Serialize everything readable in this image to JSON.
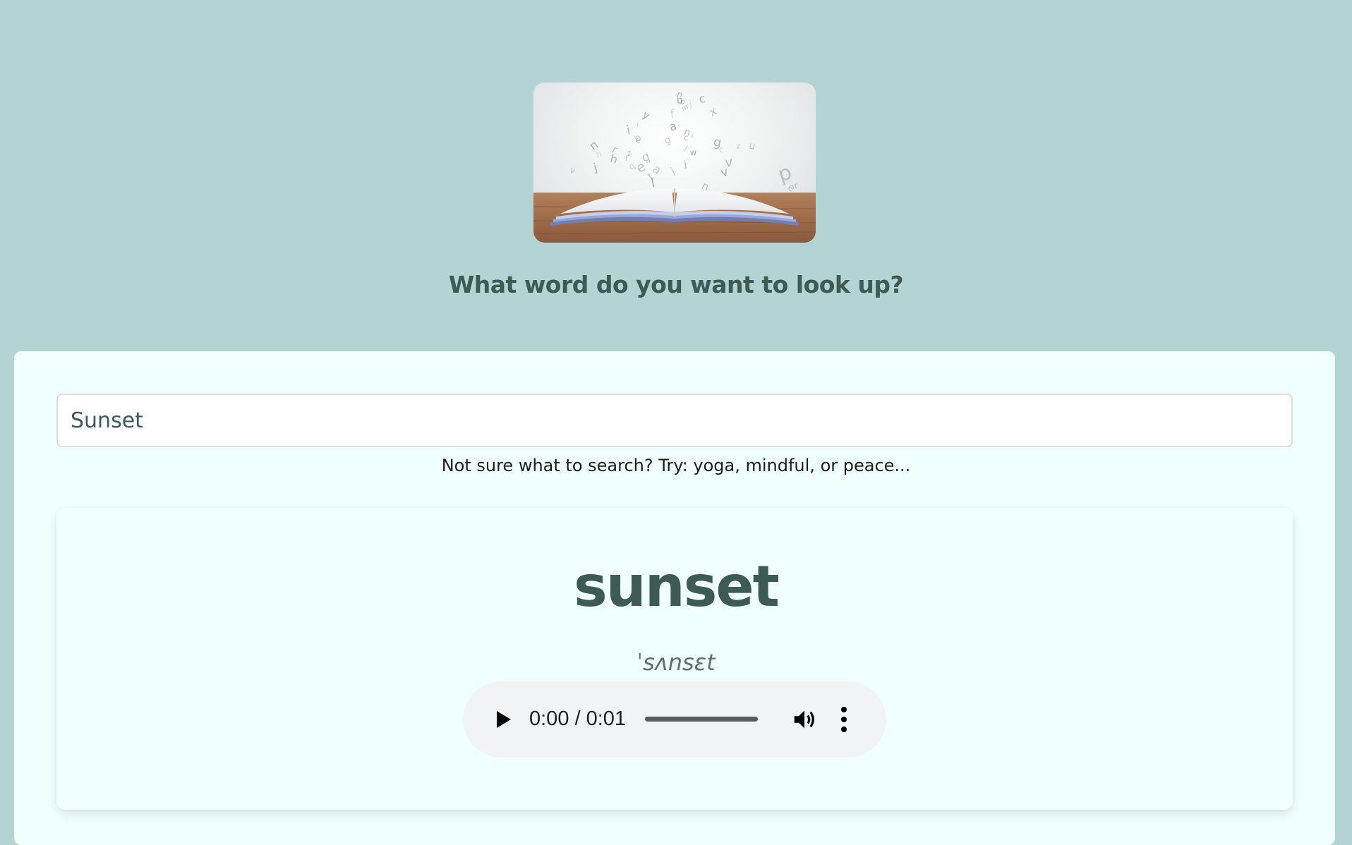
{
  "hero": {
    "image_name": "open-book-with-floating-letters",
    "letters": "abcdefghijklmnopqrstuvwxyz"
  },
  "heading": "What word do you want to look up?",
  "search": {
    "value": "Sunset",
    "hint": "Not sure what to search? Try: yoga, mindful, or peace..."
  },
  "result": {
    "word": "sunset",
    "phonetic": "ˈsʌnsɛt",
    "audio": {
      "time": "0:00 / 0:01",
      "play_icon": "play-icon",
      "volume_icon": "volume-icon",
      "more_icon": "more-vertical-icon"
    }
  },
  "colors": {
    "page_background": "#b4d4d4",
    "card_background": "#f0ffff",
    "accent_text": "#3d5a54"
  }
}
